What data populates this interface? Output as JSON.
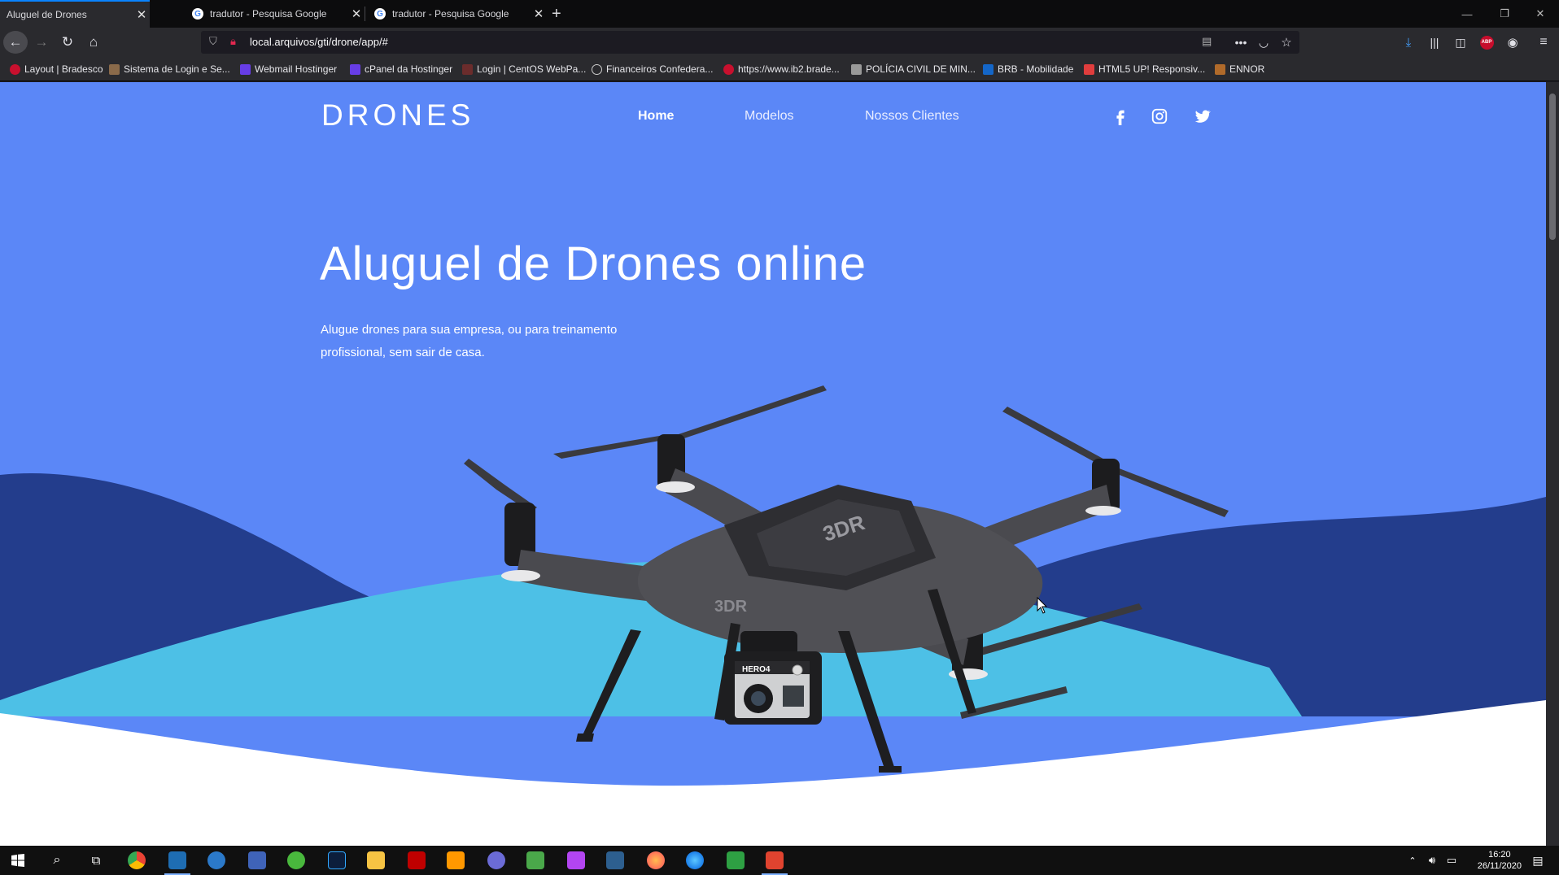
{
  "browser": {
    "tabs": [
      {
        "label": "Aluguel de Drones",
        "active": true
      },
      {
        "label": "tradutor - Pesquisa Google",
        "active": false
      },
      {
        "label": "tradutor - Pesquisa Google",
        "active": false
      }
    ],
    "new_tab": "+",
    "url": "local.arquivos/gti/drone/app/#",
    "bookmarks": [
      "Layout | Bradesco",
      "Sistema de Login e Se...",
      "Webmail Hostinger",
      "cPanel da Hostinger",
      "Login | CentOS WebPa...",
      "Financeiros Confedera...",
      "https://www.ib2.brade...",
      "POLÍCIA CIVIL DE MIN...",
      "BRB - Mobilidade",
      "HTML5 UP! Responsiv...",
      "ENNOR"
    ],
    "abp_label": "ABP"
  },
  "site": {
    "brand": "DRONES",
    "nav": [
      "Home",
      "Modelos",
      "Nossos Clientes"
    ],
    "social": [
      "facebook-icon",
      "instagram-icon",
      "twitter-icon"
    ],
    "hero_title": "Aluguel de Drones online",
    "hero_subtitle": "Alugue drones para sua empresa, ou para treinamento profissional, sem sair de casa.",
    "drone_brand": "3DR",
    "camera_label": "HERO4",
    "colors": {
      "background": "#5b87f7",
      "wave_dark": "#233d8c",
      "wave_light": "#4dc0e6",
      "ground": "#ffffff"
    }
  },
  "taskbar": {
    "time": "16:20",
    "date": "26/11/2020"
  }
}
